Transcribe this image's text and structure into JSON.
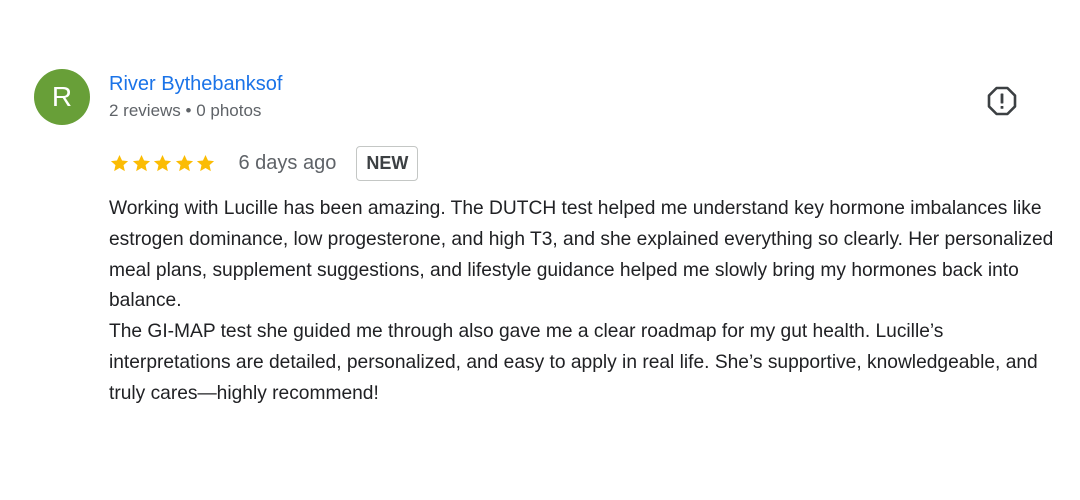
{
  "review": {
    "avatar_initial": "R",
    "avatar_color": "#689f38",
    "author_name": "River Bythebanksof",
    "author_meta": "2 reviews • 0 photos",
    "rating": 5,
    "rating_max": 5,
    "star_color": "#fbbc04",
    "date": "6 days ago",
    "badge": "NEW",
    "text": "Working with Lucille has been amazing. The DUTCH test helped me understand key hormone imbalances like estrogen dominance, low progesterone, and high T3, and she explained everything so clearly. Her personalized meal plans, supplement suggestions, and lifestyle guidance helped me slowly bring my hormones back into balance.\nThe GI-MAP test she guided me through also gave me a clear roadmap for my gut health. Lucille’s interpretations are detailed, personalized, and easy to apply in real life. She’s supportive, knowledgeable, and truly cares—highly recommend!",
    "report_icon": "report-icon"
  }
}
